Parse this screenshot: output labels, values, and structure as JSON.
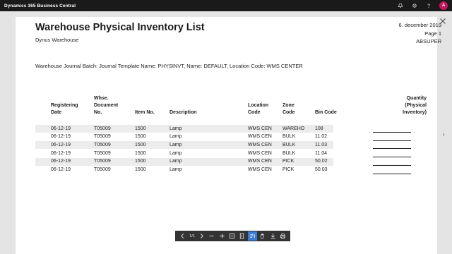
{
  "app": {
    "title": "Dynamics 365 Business Central",
    "avatar_initial": "A"
  },
  "report": {
    "title": "Warehouse Physical Inventory List",
    "subtitle": "Dynus Warehouse",
    "date": "6. december 2019",
    "page": "Page 1",
    "user": "ABSUPER",
    "batch": "Warehouse Journal Batch: Journal Template Name: PHYSINVT, Name: DEFAULT, Location Code: WMS CENTER"
  },
  "columns": {
    "reg_date": [
      "Registering",
      "Date"
    ],
    "doc_no": [
      "Whse.",
      "Document",
      "No."
    ],
    "item_no": [
      "Item No."
    ],
    "description": [
      "Description"
    ],
    "location": [
      "Location",
      "Code"
    ],
    "zone": [
      "Zone",
      "Code"
    ],
    "bin": [
      "Bin Code"
    ],
    "qty": [
      "Quantity",
      "(Physical",
      "Inventory)"
    ]
  },
  "rows": [
    {
      "date": "06-12-19",
      "doc": "T05009",
      "item": "1500",
      "desc": "Lamp",
      "loc": "WMS CEN",
      "zone": "WAREHO",
      "bin": "108"
    },
    {
      "date": "06-12-19",
      "doc": "T05009",
      "item": "1500",
      "desc": "Lamp",
      "loc": "WMS CEN",
      "zone": "BULK",
      "bin": "11.02"
    },
    {
      "date": "06-12-19",
      "doc": "T05009",
      "item": "1500",
      "desc": "Lamp",
      "loc": "WMS CEN",
      "zone": "BULK",
      "bin": "11.03"
    },
    {
      "date": "06-12-19",
      "doc": "T05009",
      "item": "1500",
      "desc": "Lamp",
      "loc": "WMS CEN",
      "zone": "BULK",
      "bin": "11.04"
    },
    {
      "date": "06-12-19",
      "doc": "T05009",
      "item": "1500",
      "desc": "Lamp",
      "loc": "WMS CEN",
      "zone": "PICK",
      "bin": "50.02"
    },
    {
      "date": "06-12-19",
      "doc": "T05009",
      "item": "1500",
      "desc": "Lamp",
      "loc": "WMS CEN",
      "zone": "PICK",
      "bin": "50.03"
    }
  ],
  "toolbar": {
    "page_indicator": "1/1"
  },
  "icons": [
    "bell-icon",
    "gear-icon",
    "help-icon",
    "close-icon",
    "prev-page-icon",
    "next-page-icon",
    "zoom-out-icon",
    "zoom-in-icon",
    "fit-page-icon",
    "fit-width-icon",
    "text-select-icon",
    "hand-tool-icon",
    "download-icon",
    "print-icon"
  ]
}
